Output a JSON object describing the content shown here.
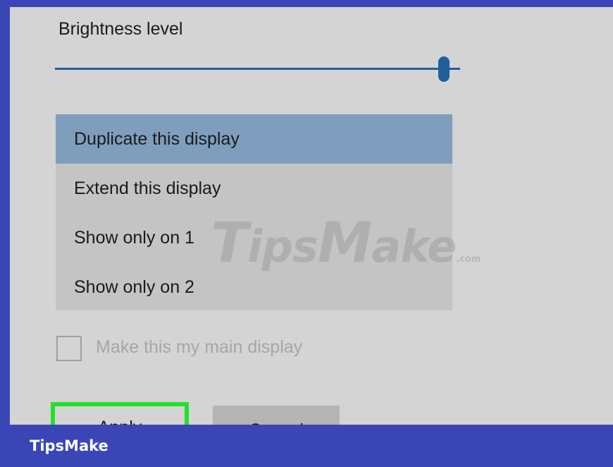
{
  "brightness": {
    "label": "Brightness level",
    "level": 0.96
  },
  "display_mode": {
    "options": [
      {
        "label": "Duplicate this display",
        "selected": true
      },
      {
        "label": "Extend this display",
        "selected": false
      },
      {
        "label": "Show only on 1",
        "selected": false
      },
      {
        "label": "Show only on 2",
        "selected": false
      }
    ]
  },
  "main_display": {
    "label": "Make this my main display",
    "checked": false,
    "disabled": true
  },
  "buttons": {
    "apply_label": "Apply",
    "cancel_label": "Cancel"
  },
  "watermark": {
    "text": "TipsMake",
    "suffix": ".com"
  },
  "footer": {
    "brand": "TipsMake"
  },
  "colors": {
    "frame": "#3a46b5",
    "panel": "#d4d4d4",
    "selected_option": "#7f9ebe",
    "slider": "#1f5f9a",
    "highlight": "#22e02e"
  }
}
